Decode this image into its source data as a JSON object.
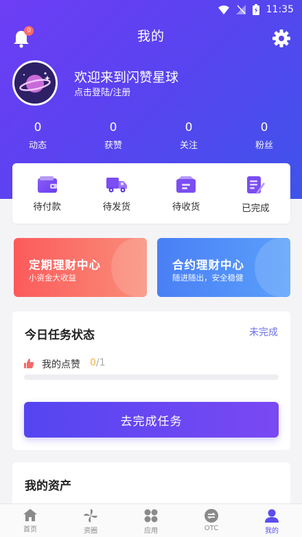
{
  "status_bar": {
    "time": "11:35"
  },
  "header": {
    "title": "我的",
    "notification_count": "0",
    "welcome_text": "欢迎来到闪赞星球",
    "login_text": "点击登陆/注册"
  },
  "stats": [
    {
      "value": "0",
      "label": "动态"
    },
    {
      "value": "0",
      "label": "获赞"
    },
    {
      "value": "0",
      "label": "关注"
    },
    {
      "value": "0",
      "label": "粉丝"
    }
  ],
  "orders": [
    {
      "label": "待付款",
      "icon": "wallet-icon"
    },
    {
      "label": "待发货",
      "icon": "truck-icon"
    },
    {
      "label": "待收货",
      "icon": "package-icon"
    },
    {
      "label": "已完成",
      "icon": "document-done-icon"
    }
  ],
  "promos": [
    {
      "title": "定期理财中心",
      "subtitle": "小资金大收益",
      "color": "#fc5b5b"
    },
    {
      "title": "合约理财中心",
      "subtitle": "随进随出，安全稳健",
      "color": "#4a7ff5"
    }
  ],
  "task": {
    "title": "今日任务状态",
    "status": "未完成",
    "item_name": "我的点赞",
    "progress_done": "0",
    "progress_total": "/1",
    "progress_fraction": 0,
    "button_label": "去完成任务"
  },
  "assets": {
    "title": "我的资产"
  },
  "tabbar": [
    {
      "label": "首页",
      "icon": "home-icon",
      "active": false
    },
    {
      "label": "资圈",
      "icon": "pinwheel-icon",
      "active": false
    },
    {
      "label": "应用",
      "icon": "apps-icon",
      "active": false
    },
    {
      "label": "OTC",
      "icon": "exchange-icon",
      "active": false
    },
    {
      "label": "我的",
      "icon": "user-icon",
      "active": true
    }
  ],
  "colors": {
    "primary": "#5b4df0",
    "accent_orange": "#f3b23e",
    "red": "#fc5b5b",
    "blue": "#4a7ff5"
  }
}
